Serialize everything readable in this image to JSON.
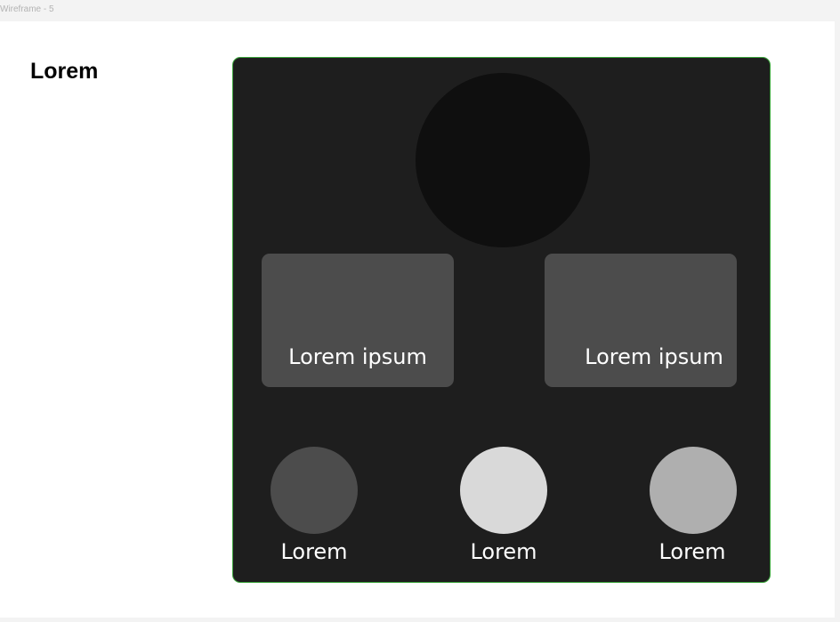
{
  "window": {
    "frame_label": "Wireframe - 5"
  },
  "page": {
    "title": "Lorem"
  },
  "card": {
    "tiles": [
      {
        "label": "Lorem ipsum"
      },
      {
        "label": "Lorem ipsum"
      }
    ],
    "options": [
      {
        "label": "Lorem",
        "color": "#4c4c4c"
      },
      {
        "label": "Lorem",
        "color": "#d9d9d9"
      },
      {
        "label": "Lorem",
        "color": "#afafaf"
      }
    ]
  },
  "colors": {
    "card_background": "#1e1e1e",
    "card_border": "#3ba43b",
    "hero_circle": "#0f0f0f",
    "tile_background": "#4c4c4c"
  }
}
